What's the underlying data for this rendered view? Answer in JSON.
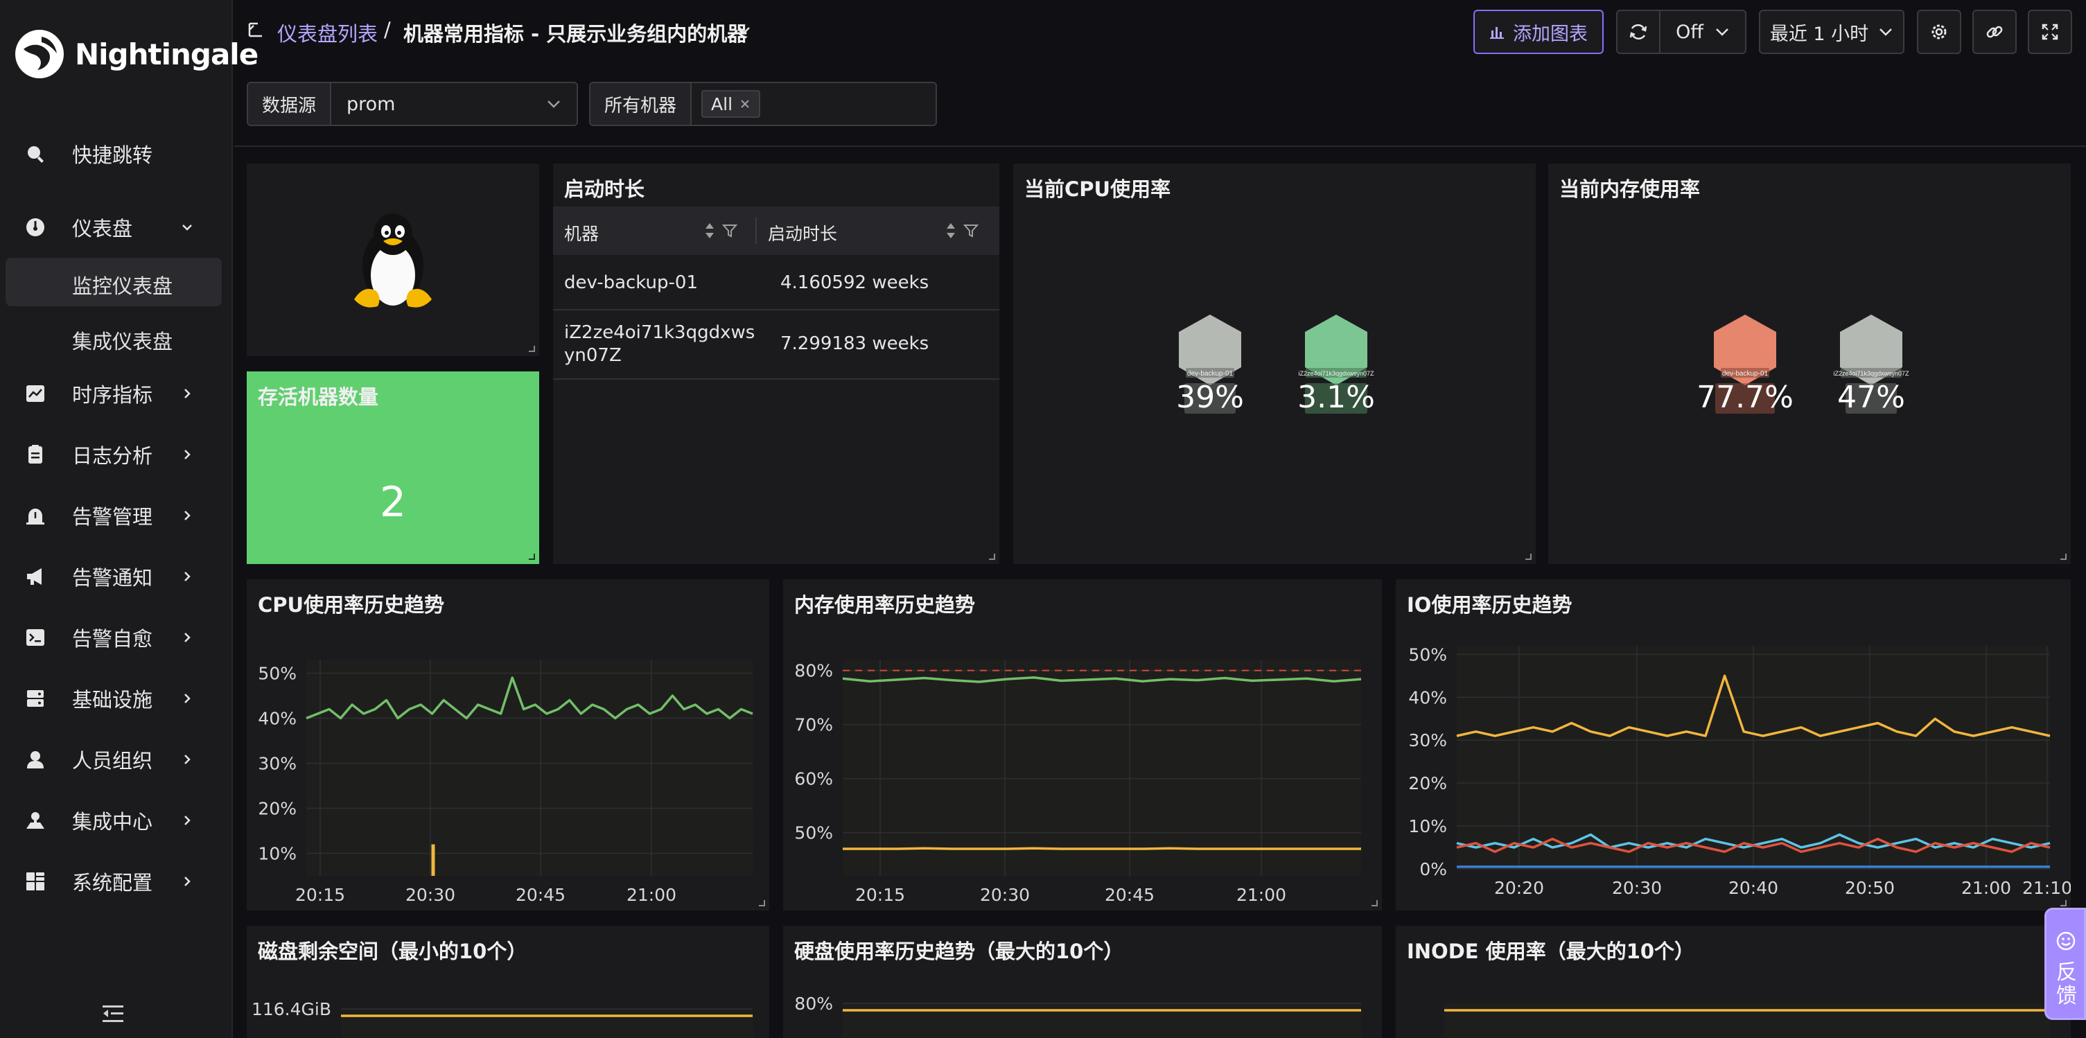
{
  "app": {
    "name": "Nightingale"
  },
  "sidebar": {
    "items": [
      {
        "label": "快捷跳转",
        "icon": "search-icon"
      },
      {
        "label": "仪表盘",
        "icon": "dashboard-icon",
        "expanded": true
      },
      {
        "label": "时序指标",
        "icon": "chart-icon"
      },
      {
        "label": "日志分析",
        "icon": "log-icon"
      },
      {
        "label": "告警管理",
        "icon": "alarm-icon"
      },
      {
        "label": "告警通知",
        "icon": "notify-icon"
      },
      {
        "label": "告警自愈",
        "icon": "terminal-icon"
      },
      {
        "label": "基础设施",
        "icon": "server-icon"
      },
      {
        "label": "人员组织",
        "icon": "user-icon"
      },
      {
        "label": "集成中心",
        "icon": "integration-icon"
      },
      {
        "label": "系统配置",
        "icon": "settings-grid-icon"
      }
    ],
    "subitems": [
      {
        "label": "监控仪表盘",
        "active": true
      },
      {
        "label": "集成仪表盘",
        "active": false
      }
    ]
  },
  "header": {
    "breadcrumb_link": "仪表盘列表",
    "separator": "/",
    "title": "机器常用指标 - 只展示业务组内的机器",
    "add_chart": "添加图表",
    "refresh_interval": "Off",
    "time_range": "最近 1 小时"
  },
  "variables": {
    "datasource_label": "数据源",
    "datasource_value": "prom",
    "machines_label": "所有机器",
    "machines_tag": "All"
  },
  "panels": {
    "alive": {
      "title": "存活机器数量",
      "value": "2",
      "color": "#60cf6f"
    },
    "uptime": {
      "title": "启动时长",
      "columns": [
        "机器",
        "启动时长"
      ],
      "rows": [
        {
          "machine": "dev-backup-01",
          "uptime": "4.160592 weeks"
        },
        {
          "machine": "iZ2ze4oi71k3qgdxwsyn07Z",
          "uptime": "7.299183 weeks"
        }
      ]
    },
    "cpu_now": {
      "title": "当前CPU使用率",
      "hexes": [
        {
          "name": "dev-backup-01",
          "value": "39%",
          "color": "#b5b9b4"
        },
        {
          "name": "iZ2ze4oi71k3qgdxwsyn07Z",
          "value": "3.1%",
          "color": "#7cc692"
        }
      ]
    },
    "mem_now": {
      "title": "当前内存使用率",
      "hexes": [
        {
          "name": "dev-backup-01",
          "value": "77.7%",
          "color": "#e5866d"
        },
        {
          "name": "iZ2ze4oi71k3qgdxwsyn07Z",
          "value": "47%",
          "color": "#b5b9b4"
        }
      ]
    },
    "cpu_hist": {
      "title": "CPU使用率历史趋势"
    },
    "mem_hist": {
      "title": "内存使用率历史趋势"
    },
    "io_hist": {
      "title": "IO使用率历史趋势"
    },
    "disk_free": {
      "title": "磁盘剩余空间（最小的10个）"
    },
    "disk_used": {
      "title": "硬盘使用率历史趋势（最大的10个）"
    },
    "inode": {
      "title": "INODE 使用率（最大的10个）"
    }
  },
  "chart_data": [
    {
      "type": "line",
      "title": "CPU使用率历史趋势",
      "x_ticks": [
        "20:15",
        "20:30",
        "20:45",
        "21:00"
      ],
      "y_ticks": [
        "50%",
        "40%",
        "30%",
        "20%",
        "10%"
      ],
      "ylim": [
        5,
        53
      ],
      "series": [
        {
          "color": "#73bf69",
          "values": [
            40,
            41,
            42,
            40,
            43,
            41,
            42,
            44,
            40,
            42,
            43,
            41,
            44,
            42,
            40,
            43,
            42,
            41,
            49,
            42,
            43,
            41,
            42,
            44,
            41,
            43,
            42,
            40,
            42,
            43,
            41,
            42,
            45,
            42,
            43,
            41,
            42,
            40,
            42,
            41
          ]
        },
        {
          "color": "#f2b63d",
          "values": [
            {
              "t": "20:30",
              "v": 12
            }
          ]
        }
      ]
    },
    {
      "type": "line",
      "title": "内存使用率历史趋势",
      "x_ticks": [
        "20:15",
        "20:30",
        "20:45",
        "21:00"
      ],
      "y_ticks": [
        "80%",
        "70%",
        "60%",
        "50%"
      ],
      "ylim": [
        42,
        82
      ],
      "threshold": 80,
      "series": [
        {
          "color": "#73bf69",
          "values": [
            78.5,
            78,
            78.3,
            78.6,
            78.2,
            77.9,
            78.4,
            78.7,
            78.1,
            78.3,
            78.5,
            78,
            78.4,
            78.2,
            78.6,
            78.1,
            78.3,
            78.5,
            78,
            78.4
          ]
        },
        {
          "color": "#f2b63d",
          "values": [
            47,
            47,
            47,
            47.1,
            47,
            47,
            47,
            47.1,
            47,
            47,
            47,
            47,
            47.1,
            47,
            47,
            47,
            47,
            47,
            47,
            47
          ]
        }
      ]
    },
    {
      "type": "line",
      "title": "IO使用率历史趋势",
      "x_ticks": [
        "20:20",
        "20:30",
        "20:40",
        "20:50",
        "21:00",
        "21:10"
      ],
      "y_ticks": [
        "50%",
        "40%",
        "30%",
        "20%",
        "10%",
        "0%"
      ],
      "ylim": [
        0,
        52
      ],
      "series": [
        {
          "color": "#f2b63d",
          "values": [
            31,
            32,
            31,
            32,
            33,
            32,
            34,
            32,
            31,
            33,
            32,
            31,
            32,
            31,
            45,
            32,
            31,
            32,
            33,
            31,
            32,
            33,
            34,
            32,
            31,
            35,
            32,
            31,
            32,
            33,
            32,
            31
          ]
        },
        {
          "color": "#5ec4e5",
          "values": [
            6,
            5,
            6,
            5,
            7,
            5,
            6,
            8,
            5,
            6,
            5,
            6,
            5,
            7,
            6,
            5,
            6,
            7,
            5,
            6,
            8,
            6,
            5,
            6,
            7,
            5,
            6,
            5,
            7,
            6,
            5,
            6
          ]
        },
        {
          "color": "#e0533e",
          "values": [
            5,
            6,
            4,
            6,
            5,
            7,
            5,
            6,
            5,
            4,
            6,
            5,
            6,
            5,
            4,
            6,
            5,
            6,
            4,
            5,
            6,
            5,
            7,
            5,
            4,
            6,
            5,
            6,
            5,
            4,
            6,
            5
          ]
        },
        {
          "color": "#3d7fd6",
          "values": [
            0.5,
            0.5,
            0.5,
            0.5,
            0.5,
            0.5,
            0.5,
            0.5,
            0.5,
            0.5,
            0.5,
            0.5,
            0.5,
            0.5,
            0.5,
            0.5,
            0.5,
            0.5,
            0.5,
            0.5,
            0.5,
            0.5,
            0.5,
            0.5,
            0.5,
            0.5,
            0.5,
            0.5,
            0.5,
            0.5,
            0.5,
            0.5
          ]
        }
      ]
    },
    {
      "type": "line",
      "title": "磁盘剩余空间（最小的10个）",
      "y_ticks": [
        "116.4GiB"
      ],
      "series": [
        {
          "color": "#f2b63d",
          "values": [
            116.4,
            116.4,
            116.4,
            116.4
          ]
        }
      ]
    },
    {
      "type": "line",
      "title": "硬盘使用率历史趋势（最大的10个）",
      "y_ticks": [
        "80%"
      ],
      "series": [
        {
          "color": "#f2b63d",
          "values": [
            80,
            80,
            80,
            80
          ]
        }
      ]
    },
    {
      "type": "line",
      "title": "INODE 使用率（最大的10个）",
      "series": [
        {
          "color": "#f2b63d",
          "values": [
            1,
            1,
            1,
            1
          ]
        }
      ]
    }
  ],
  "feedback": {
    "label": "反馈"
  }
}
